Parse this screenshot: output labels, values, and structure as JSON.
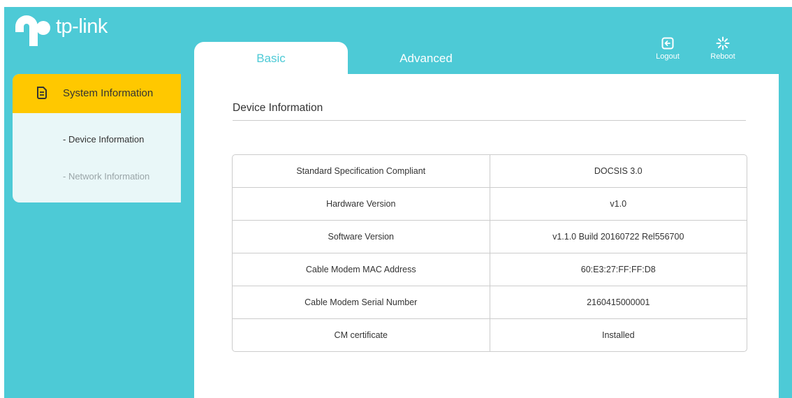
{
  "brand": {
    "name": "tp-link"
  },
  "tabs": [
    {
      "label": "Basic",
      "active": true
    },
    {
      "label": "Advanced",
      "active": false
    }
  ],
  "header_actions": {
    "logout": {
      "label": "Logout",
      "icon": "logout-icon"
    },
    "reboot": {
      "label": "Reboot",
      "icon": "reboot-icon"
    }
  },
  "sidebar": {
    "section": {
      "label": "System Information",
      "icon": "document-icon"
    },
    "items": [
      {
        "label": "- Device Information",
        "active": true
      },
      {
        "label": "- Network Information",
        "active": false
      }
    ]
  },
  "main": {
    "section_title": "Device Information",
    "rows": [
      {
        "key": "Standard Specification Compliant",
        "value": "DOCSIS 3.0"
      },
      {
        "key": "Hardware Version",
        "value": "v1.0"
      },
      {
        "key": "Software Version",
        "value": "v1.1.0 Build 20160722 Rel556700"
      },
      {
        "key": "Cable Modem MAC Address",
        "value": "60:E3:27:FF:FF:D8"
      },
      {
        "key": "Cable Modem Serial Number",
        "value": "2160415000001"
      },
      {
        "key": "CM certificate",
        "value": "Installed"
      }
    ]
  },
  "colors": {
    "brand_teal": "#4dcad6",
    "highlight_yellow": "#ffc800",
    "sidebar_bg": "#e9f7f8"
  }
}
